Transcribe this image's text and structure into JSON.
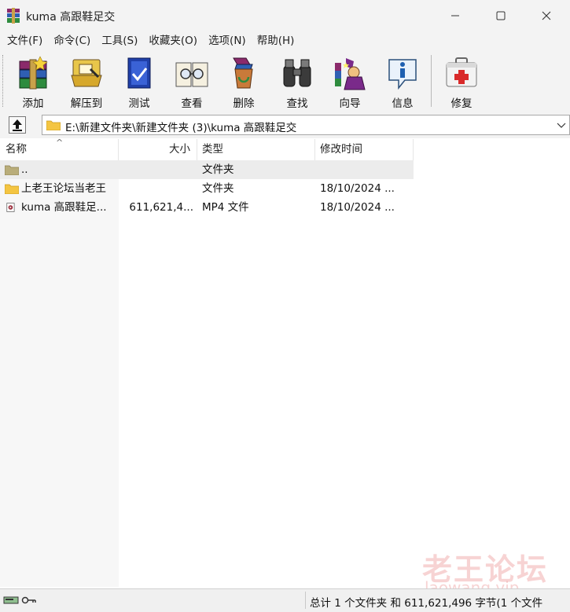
{
  "window": {
    "title": "kuma 高跟鞋足交",
    "controls": {
      "minimize": "—",
      "maximize": "☐",
      "close": "✕"
    }
  },
  "menu": [
    "文件(F)",
    "命令(C)",
    "工具(S)",
    "收藏夹(O)",
    "选项(N)",
    "帮助(H)"
  ],
  "toolbar": [
    {
      "label": "添加",
      "icon": "add-archive-icon"
    },
    {
      "label": "解压到",
      "icon": "extract-to-icon"
    },
    {
      "label": "测试",
      "icon": "test-icon"
    },
    {
      "label": "查看",
      "icon": "view-icon"
    },
    {
      "label": "删除",
      "icon": "delete-icon"
    },
    {
      "label": "查找",
      "icon": "find-icon"
    },
    {
      "label": "向导",
      "icon": "wizard-icon"
    },
    {
      "label": "信息",
      "icon": "info-icon"
    },
    {
      "label": "修复",
      "icon": "repair-icon"
    }
  ],
  "address": {
    "path": "E:\\新建文件夹\\新建文件夹 (3)\\kuma 高跟鞋足交"
  },
  "columns": {
    "name": "名称",
    "size": "大小",
    "type": "类型",
    "modified": "修改时间",
    "sort_indicator": "^"
  },
  "rows": [
    {
      "name": "..",
      "size": "",
      "type": "文件夹",
      "modified": "",
      "icon": "parent-folder-icon",
      "selected": true
    },
    {
      "name": "上老王论坛当老王",
      "size": "",
      "type": "文件夹",
      "modified": "18/10/2024 ...",
      "icon": "folder-icon",
      "selected": false
    },
    {
      "name": "kuma 高跟鞋足...",
      "size": "611,621,4...",
      "type": "MP4 文件",
      "modified": "18/10/2024 ...",
      "icon": "video-file-icon",
      "selected": false
    }
  ],
  "status": {
    "summary": "总计 1 个文件夹 和 611,621,496 字节(1 个文件"
  },
  "watermark": {
    "main": "老王论坛",
    "sub": "laowang.vip"
  },
  "colors": {
    "folder": "#f4c542",
    "chrome": "#f3f3f3",
    "selected_row": "#ececec",
    "watermark": "#e88282"
  }
}
